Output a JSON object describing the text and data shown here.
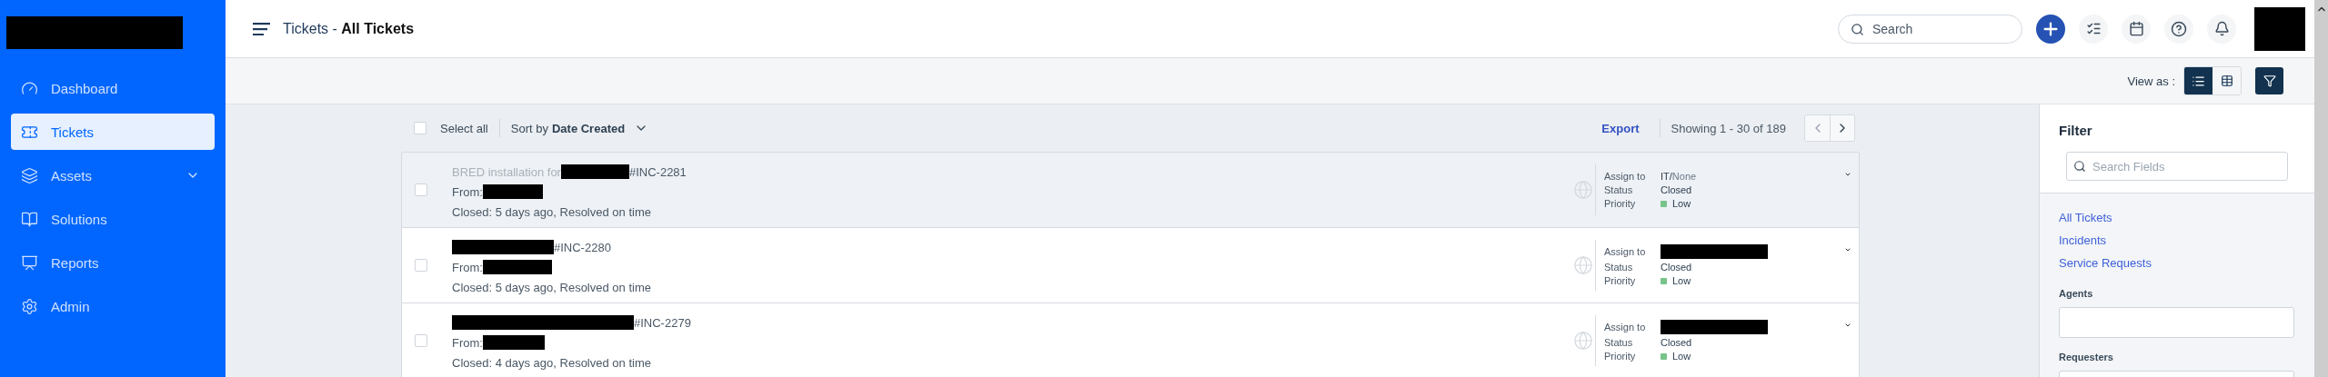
{
  "sidebar": {
    "items": [
      {
        "label": "Dashboard",
        "selected": false,
        "expandable": false
      },
      {
        "label": "Tickets",
        "selected": true,
        "expandable": false
      },
      {
        "label": "Assets",
        "selected": false,
        "expandable": true
      },
      {
        "label": "Solutions",
        "selected": false,
        "expandable": false
      },
      {
        "label": "Reports",
        "selected": false,
        "expandable": false
      },
      {
        "label": "Admin",
        "selected": false,
        "expandable": false
      }
    ]
  },
  "header": {
    "title": "Tickets - **All Tickets**",
    "search_placeholder": "Search"
  },
  "view_as": {
    "label": "View as :",
    "options": [
      {
        "selected": true
      },
      {
        "selected": false
      }
    ]
  },
  "toolbar": {
    "select_all": {
      "label": "Select all",
      "checked": false
    },
    "sort_label": "Sort by",
    "sort_value": "Date Created",
    "export": "Export",
    "showing": "Showing 1 - 30 of 189"
  },
  "tickets": [
    {
      "selected": true,
      "checked": false,
      "subject": "BRED installation for",
      "id": "#INC-2281",
      "from": "From:",
      "closed": "Closed: 5 days ago, Resolved on time",
      "assign_label": "Assign to",
      "assign_group": "IT/",
      "assign_agent": "None",
      "status_label": "Status",
      "status": "Closed",
      "priority_label": "Priority",
      "priority": "Low"
    },
    {
      "selected": false,
      "checked": false,
      "id": "#INC-2280",
      "from": "From:",
      "closed": "Closed: 5 days ago, Resolved on time",
      "assign_label": "Assign to",
      "status_label": "Status",
      "status": "Closed",
      "priority_label": "Priority",
      "priority": "Low"
    },
    {
      "selected": false,
      "checked": false,
      "id": "#INC-2279",
      "from": "From:",
      "closed": "Closed: 4 days ago, Resolved on time",
      "assign_label": "Assign to",
      "status_label": "Status",
      "status": "Closed",
      "priority_label": "Priority",
      "priority": "Low"
    }
  ],
  "filter": {
    "title": "Filter",
    "search_placeholder": "Search Fields",
    "links": [
      "All Tickets",
      "Incidents",
      "Service Requests"
    ],
    "fields": [
      {
        "label": "Agents"
      },
      {
        "label": "Requesters"
      }
    ]
  }
}
